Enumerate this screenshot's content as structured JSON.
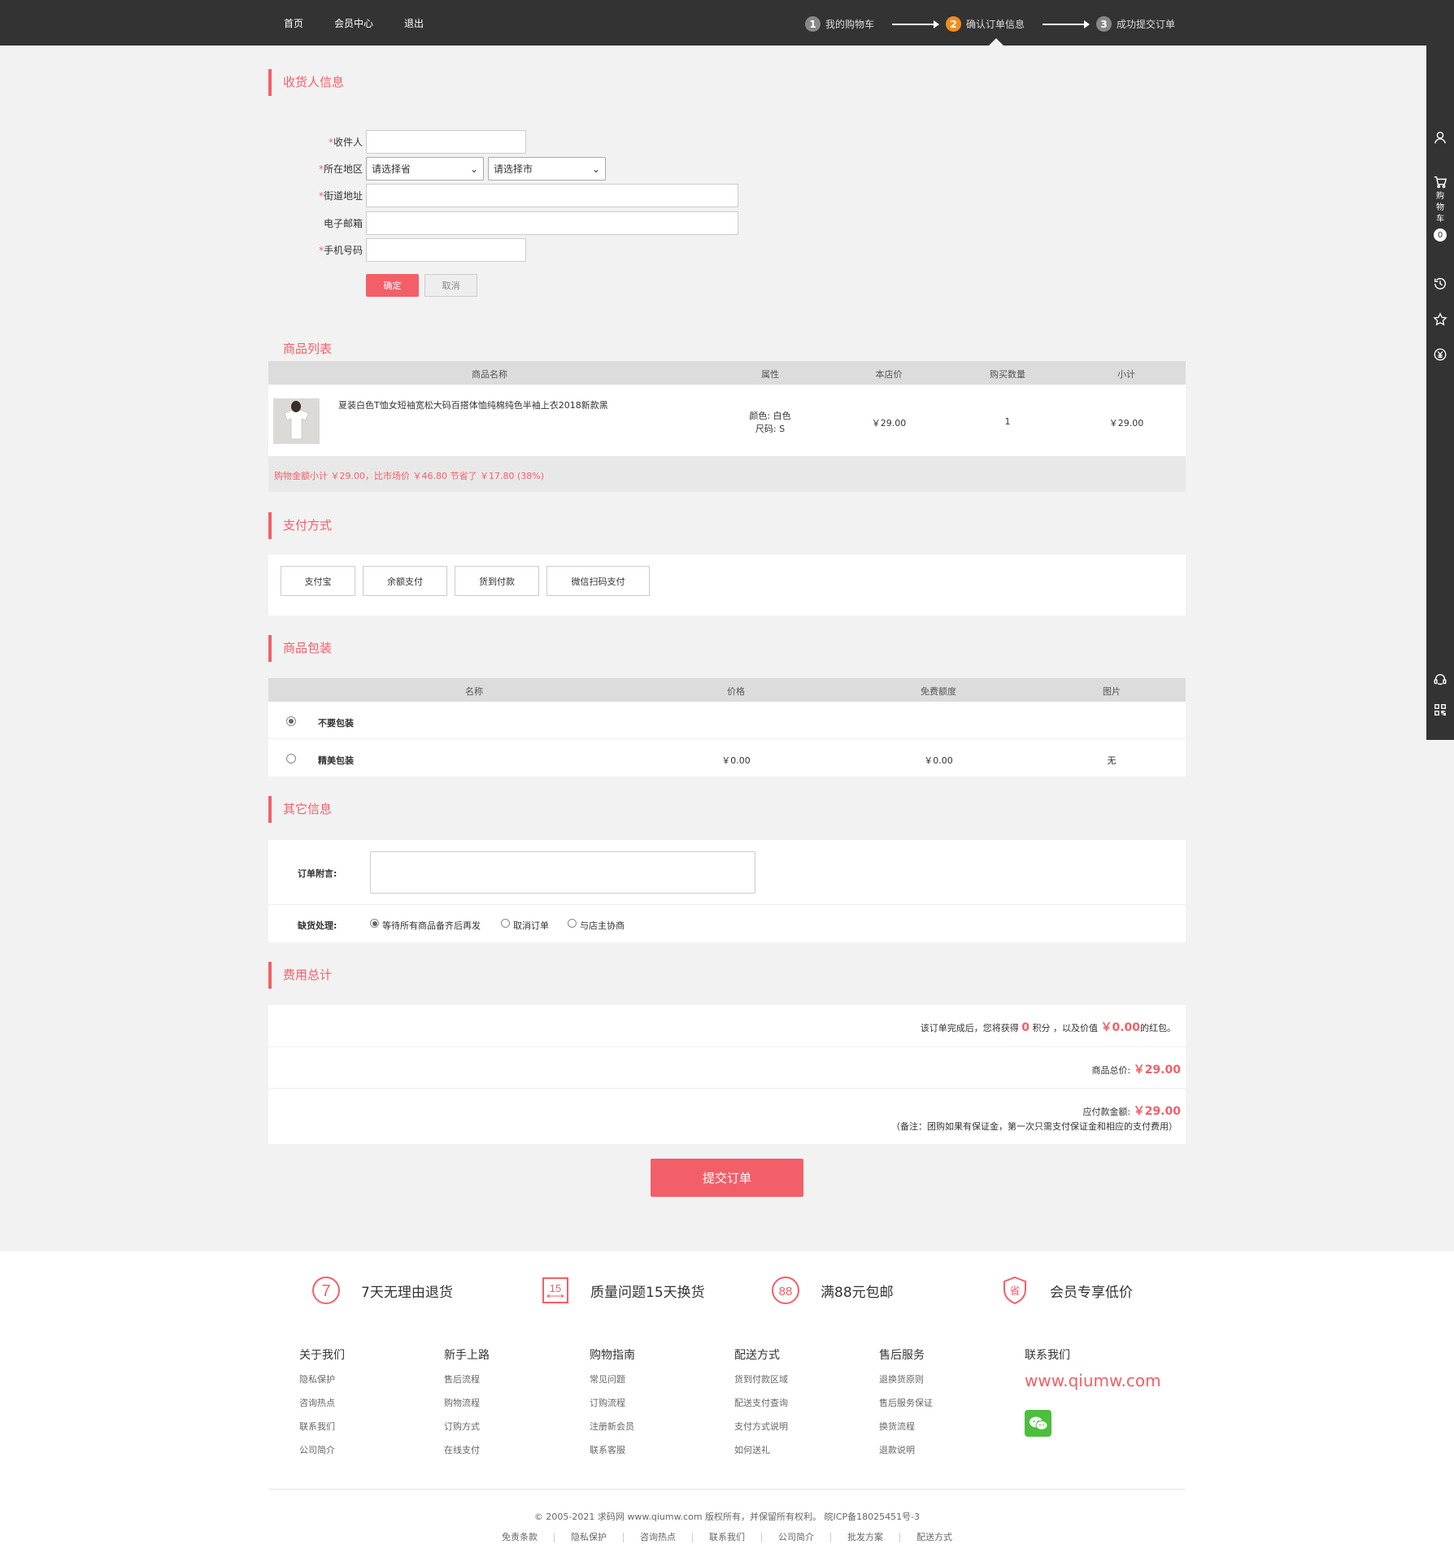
{
  "topnav": {
    "home": "首页",
    "member": "会员中心",
    "logout": "退出"
  },
  "steps": [
    {
      "num": "1",
      "label": "我的购物车"
    },
    {
      "num": "2",
      "label": "确认订单信息"
    },
    {
      "num": "3",
      "label": "成功提交订单"
    }
  ],
  "sidebar": {
    "cart_label": [
      "购",
      "物",
      "车"
    ],
    "cart_count": "0"
  },
  "receiver": {
    "title": "收货人信息",
    "name_label": "收件人",
    "region_label": "所在地区",
    "province_select": "请选择省",
    "city_select": "请选择市",
    "street_label": "街道地址",
    "email_label": "电子邮箱",
    "phone_label": "手机号码",
    "required_mark": "*",
    "ok_button": "确定",
    "cancel_button": "取消"
  },
  "goods": {
    "title": "商品列表",
    "headers": [
      "商品名称",
      "属性",
      "本店价",
      "购买数量",
      "小计"
    ],
    "row": {
      "name": "夏装白色T恤女短袖宽松大码百搭体恤纯棉纯色半袖上衣2018新款黑",
      "attr_color": "颜色: 白色",
      "attr_size": "尺码: S",
      "price": "￥29.00",
      "qty": "1",
      "subtotal": "￥29.00"
    },
    "summary": "购物金额小计 ￥29.00，比市场价 ￥46.80 节省了 ￥17.80 (38%)"
  },
  "payment": {
    "title": "支付方式",
    "options": [
      "支付宝",
      "余额支付",
      "货到付款",
      "微信扫码支付"
    ]
  },
  "packaging": {
    "title": "商品包装",
    "headers": [
      "名称",
      "价格",
      "免费额度",
      "图片"
    ],
    "rows": [
      {
        "name": "不要包装",
        "price": "",
        "free": "",
        "image": ""
      },
      {
        "name": "精美包装",
        "price": "￥0.00",
        "free": "￥0.00",
        "image": "无"
      }
    ]
  },
  "other": {
    "title": "其它信息",
    "note_label": "订单附言:",
    "shortage_label": "缺货处理:",
    "shortage_options": [
      "等待所有商品备齐后再发",
      "取消订单",
      "与店主协商"
    ]
  },
  "totals": {
    "title": "费用总计",
    "points_prefix": "该订单完成后，您将获得",
    "points_value": "0",
    "points_mid": "积分 ，以及价值",
    "bonus_value": "￥0.00",
    "bonus_suffix": "的红包。",
    "goods_total_label": "商品总价:",
    "goods_total": "￥29.00",
    "payable_label": "应付款金额:",
    "payable": "￥29.00",
    "note": "（备注：团购如果有保证金，第一次只需支付保证金和相应的支付费用）"
  },
  "submit_button": "提交订单",
  "promises": [
    {
      "icon_text": "7",
      "label": "7天无理由退货"
    },
    {
      "icon_text": "15",
      "label": "质量问题15天换货"
    },
    {
      "icon_text": "88",
      "label": "满88元包邮"
    },
    {
      "icon_text": "省",
      "label": "会员专享低价"
    }
  ],
  "footer_cols": [
    {
      "title": "关于我们",
      "links": [
        "隐私保护",
        "咨询热点",
        "联系我们",
        "公司简介"
      ]
    },
    {
      "title": "新手上路",
      "links": [
        "售后流程",
        "购物流程",
        "订购方式",
        "在线支付"
      ]
    },
    {
      "title": "购物指南",
      "links": [
        "常见问题",
        "订购流程",
        "注册新会员",
        "联系客服"
      ]
    },
    {
      "title": "配送方式",
      "links": [
        "货到付款区域",
        "配送支付查询",
        "支付方式说明",
        "如何送礼"
      ]
    },
    {
      "title": "售后服务",
      "links": [
        "退换货原则",
        "售后服务保证",
        "换货流程",
        "退款说明"
      ]
    }
  ],
  "contact": {
    "title": "联系我们",
    "site": "www.qiumw.com"
  },
  "copyright": "© 2005-2021 求码网 www.qiumw.com 版权所有，并保留所有权利。 皖ICP备18025451号-3",
  "bottom_links": [
    "免责条款",
    "隐私保护",
    "咨询热点",
    "联系我们",
    "公司简介",
    "批发方案",
    "配送方式"
  ],
  "colors": {
    "accent": "#f35f68",
    "topbar": "#333333",
    "step_active": "#f18d1e",
    "wechat": "#4cbf3c"
  }
}
